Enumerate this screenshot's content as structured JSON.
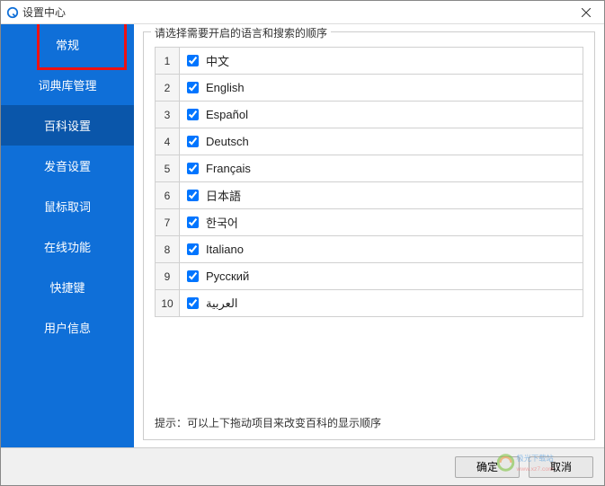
{
  "window": {
    "title": "设置中心"
  },
  "sidebar": {
    "items": [
      {
        "label": "常规"
      },
      {
        "label": "词典库管理"
      },
      {
        "label": "百科设置"
      },
      {
        "label": "发音设置"
      },
      {
        "label": "鼠标取词"
      },
      {
        "label": "在线功能"
      },
      {
        "label": "快捷键"
      },
      {
        "label": "用户信息"
      }
    ],
    "active_index": 2
  },
  "group": {
    "title": "请选择需要开启的语言和搜索的顺序",
    "languages": [
      {
        "num": "1",
        "label": "中文",
        "checked": true
      },
      {
        "num": "2",
        "label": "English",
        "checked": true
      },
      {
        "num": "3",
        "label": "Español",
        "checked": true
      },
      {
        "num": "4",
        "label": "Deutsch",
        "checked": true
      },
      {
        "num": "5",
        "label": "Français",
        "checked": true
      },
      {
        "num": "6",
        "label": "日本語",
        "checked": true
      },
      {
        "num": "7",
        "label": "한국어",
        "checked": true
      },
      {
        "num": "8",
        "label": "Italiano",
        "checked": true
      },
      {
        "num": "9",
        "label": "Русский",
        "checked": true
      },
      {
        "num": "10",
        "label": "العربية",
        "checked": true
      }
    ],
    "hint": "提示：可以上下拖动项目来改变百科的显示顺序"
  },
  "footer": {
    "ok": "确定",
    "cancel": "取消"
  },
  "watermark": {
    "line1": "极光下载站",
    "line2": "www.xz7.com"
  }
}
